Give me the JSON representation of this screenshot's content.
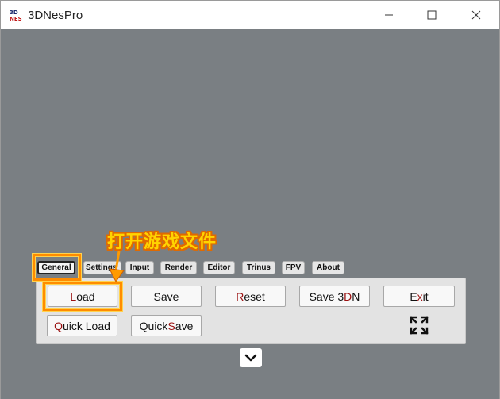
{
  "window": {
    "title": "3DNesPro",
    "icon_name": "3dnes-logo-icon"
  },
  "tabs": [
    {
      "label": "General",
      "active": true
    },
    {
      "label": "Settings",
      "active": false
    },
    {
      "label": "Input",
      "active": false
    },
    {
      "label": "Render",
      "active": false
    },
    {
      "label": "Editor",
      "active": false
    },
    {
      "label": "Trinus",
      "active": false
    },
    {
      "label": "FPV",
      "active": false
    },
    {
      "label": "About",
      "active": false
    }
  ],
  "buttons": {
    "load": {
      "hotkey": "L",
      "rest": "oad"
    },
    "save": {
      "label": "Save"
    },
    "reset": {
      "hotkey": "R",
      "rest": "eset"
    },
    "save3dn_pre": "Save 3",
    "save3dn_hotkey": "D",
    "save3dn_post": "N",
    "exit": {
      "pre": "E",
      "hotkey": "x",
      "post": "it"
    },
    "quick_load": {
      "hotkey": "Q",
      "rest": "uick Load"
    },
    "quick_save": {
      "pre": "Quick ",
      "hotkey": "S",
      "rest": "ave"
    }
  },
  "annotation": {
    "text": "打开游戏文件"
  },
  "colors": {
    "viewport": "#7a7f83",
    "hotkey": "#9b1111",
    "highlight": "#ff8c00",
    "annotation_fill": "#ffd400"
  }
}
